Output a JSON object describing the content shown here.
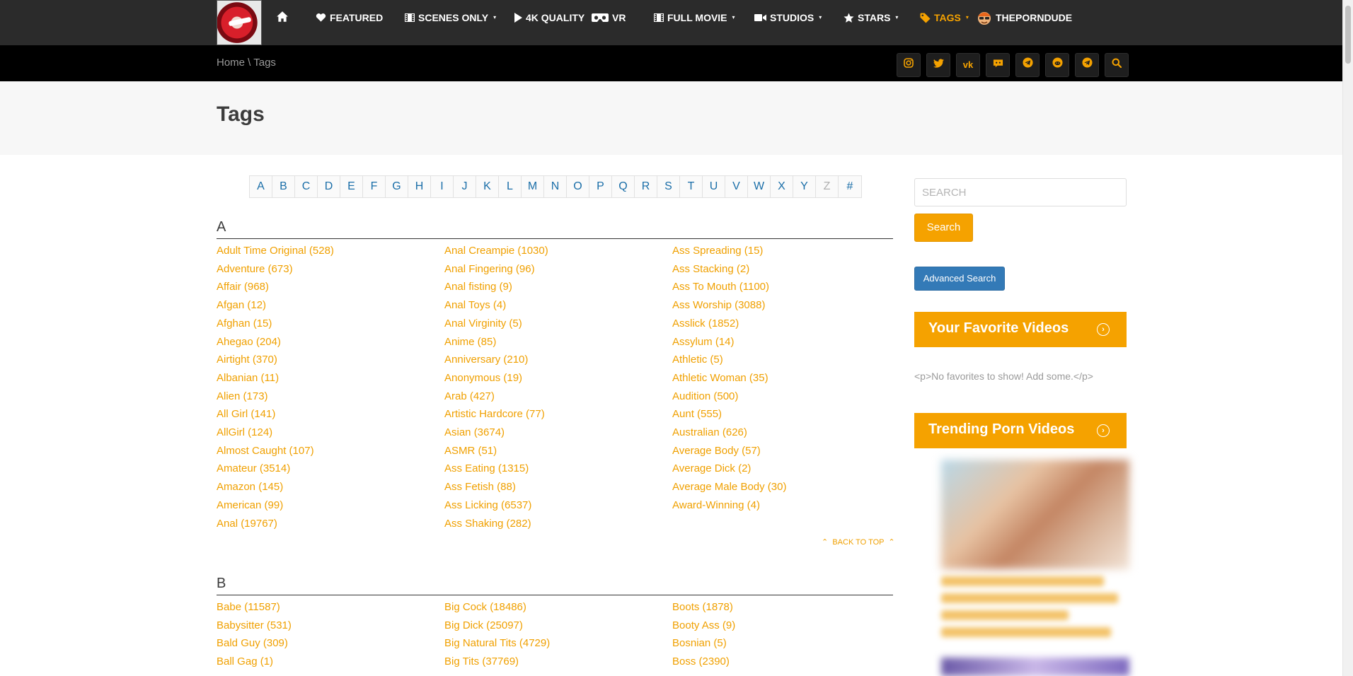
{
  "nav": {
    "items": [
      {
        "label": "FEATURED",
        "icon": "heart-icon",
        "caret": false
      },
      {
        "label": "SCENES ONLY",
        "icon": "film-icon",
        "caret": true
      },
      {
        "label": "4K QUALITY",
        "icon": "play-icon",
        "caret": false
      },
      {
        "label": "VR",
        "icon": "vr-headset-icon",
        "caret": false
      },
      {
        "label": "FULL MOVIE",
        "icon": "film-icon",
        "caret": true
      },
      {
        "label": "STUDIOS",
        "icon": "video-camera-icon",
        "caret": true
      },
      {
        "label": "STARS",
        "icon": "star-icon",
        "caret": true
      },
      {
        "label": "TAGS",
        "icon": "tag-icon",
        "caret": true,
        "active": true
      },
      {
        "label": "THEPORNDUDE",
        "icon": "porndude-avatar-icon",
        "caret": false
      }
    ],
    "accent_color": "#f5a200"
  },
  "breadcrumb": {
    "home": "Home",
    "separator": " \\ ",
    "current": "Tags"
  },
  "social": [
    "instagram-icon",
    "twitter-icon",
    "vk-icon",
    "discord-icon",
    "telegram-icon",
    "reddit-icon",
    "telegram-icon",
    "search-icon"
  ],
  "page_title": "Tags",
  "letters": [
    "A",
    "B",
    "C",
    "D",
    "E",
    "F",
    "G",
    "H",
    "I",
    "J",
    "K",
    "L",
    "M",
    "N",
    "O",
    "P",
    "Q",
    "R",
    "S",
    "T",
    "U",
    "V",
    "W",
    "X",
    "Y",
    "Z",
    "#"
  ],
  "disabled_letters": [
    "Z"
  ],
  "sections": [
    {
      "letter": "A",
      "columns": [
        [
          "Adult Time Original (528)",
          "Adventure (673)",
          "Affair (968)",
          "Afgan (12)",
          "Afghan (15)",
          "Ahegao (204)",
          "Airtight (370)",
          "Albanian (11)",
          "Alien (173)",
          "All Girl (141)",
          "AllGirl (124)",
          "Almost Caught (107)",
          "Amateur (3514)",
          "Amazon (145)",
          "American (99)",
          "Anal (19767)"
        ],
        [
          "Anal Creampie (1030)",
          "Anal Fingering (96)",
          "Anal fisting (9)",
          "Anal Toys (4)",
          "Anal Virginity (5)",
          "Anime (85)",
          "Anniversary (210)",
          "Anonymous (19)",
          "Arab (427)",
          "Artistic Hardcore (77)",
          "Asian (3674)",
          "ASMR (51)",
          "Ass Eating (1315)",
          "Ass Fetish (88)",
          "Ass Licking (6537)",
          "Ass Shaking (282)"
        ],
        [
          "Ass Spreading (15)",
          "Ass Stacking (2)",
          "Ass To Mouth (1100)",
          "Ass Worship (3088)",
          "Asslick (1852)",
          "Assylum (14)",
          "Athletic (5)",
          "Athletic Woman (35)",
          "Audition (500)",
          "Aunt (555)",
          "Australian (626)",
          "Average Body (57)",
          "Average Dick (2)",
          "Average Male Body (30)",
          "Award-Winning (4)"
        ]
      ]
    },
    {
      "letter": "B",
      "columns": [
        [
          "Babe (11587)",
          "Babysitter (531)",
          "Bald Guy (309)",
          "Ball Gag (1)"
        ],
        [
          "Big Cock (18486)",
          "Big Dick (25097)",
          "Big Natural Tits (4729)",
          "Big Tits (37769)"
        ],
        [
          "Boots (1878)",
          "Booty Ass (9)",
          "Bosnian (5)",
          "Boss (2390)"
        ]
      ]
    }
  ],
  "back_to_top": "BACK TO TOP",
  "sidebar": {
    "search_placeholder": "SEARCH",
    "search_button": "Search",
    "advanced_button": "Advanced Search",
    "favorites_title": "Your Favorite Videos",
    "favorites_empty": "<p>No favorites to show! Add some.</p>",
    "trending_title": "Trending Porn Videos"
  }
}
